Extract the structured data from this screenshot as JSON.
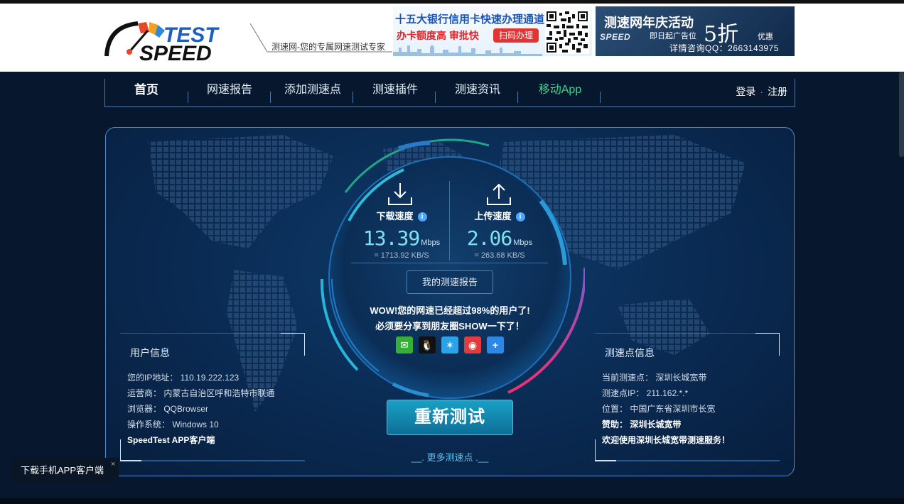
{
  "header": {
    "logo_text": [
      "TEST",
      "SPEED"
    ],
    "slogan": "测速网-您的专属网速测试专家",
    "ad1": {
      "title": "十五大银行信用卡快速办理通道",
      "subtitle": "办卡额度高 审批快",
      "button": "扫码办理"
    },
    "ad2": {
      "title": "测速网年庆活动",
      "line1": "即日起广告位",
      "line2": "详情咨询QQ：2663143975",
      "discount": "5折",
      "discount_suffix": "优惠",
      "logo_text": "SPEED"
    }
  },
  "nav": {
    "items": [
      "首页",
      "网速报告",
      "添加测速点",
      "测速插件",
      "测速资讯",
      "移动App"
    ],
    "login": "登录",
    "dot": "·",
    "register": "注册"
  },
  "speed": {
    "download": {
      "label": "下载速度",
      "value": "13.39",
      "unit": "Mbps",
      "kb": "= 1713.92 KB/S"
    },
    "upload": {
      "label": "上传速度",
      "value": "2.06",
      "unit": "Mbps",
      "kb": "= 263.68 KB/S"
    },
    "info_glyph": "i",
    "report_button": "我的测速报告",
    "wow_line1": "WOW!您的网速已经超过98%的用户了!",
    "wow_line2": "必须要分享到朋友圈SHOW一下了！",
    "retest_button": "重新测试",
    "more_nodes": "更多测速点"
  },
  "share": {
    "icons": [
      "wechat-icon",
      "qq-icon",
      "qzone-icon",
      "weibo-icon",
      "more-icon"
    ],
    "glyphs": [
      "✉",
      "🐧",
      "✶",
      "◉",
      "+"
    ],
    "colors": [
      "#35b035",
      "#111",
      "#2aa3e8",
      "#e33b3b",
      "#2d88e5"
    ]
  },
  "user_info": {
    "title": "用户信息",
    "rows": [
      "您的IP地址： 110.19.222.123",
      "运营商： 内蒙古自治区呼和浩特市联通",
      "浏览器： QQBrowser",
      "操作系统： Windows 10"
    ],
    "app_link": "SpeedTest APP客户端"
  },
  "node_info": {
    "title": "测速点信息",
    "rows": [
      "当前测速点： 深圳长城宽带",
      "测速点IP： 211.162.*.*",
      "位置： 中国广东省深圳市长宽"
    ],
    "sponsor": "赞助： 深圳长城宽带",
    "welcome": "欢迎使用深圳长城宽带测速服务！"
  },
  "download_app": {
    "label": "下载手机APP客户端",
    "close": "×"
  },
  "colors": {
    "accent": "#3fd58d",
    "panel_border": "#4a8ed0",
    "speed_digit": "#7fe0f0"
  }
}
